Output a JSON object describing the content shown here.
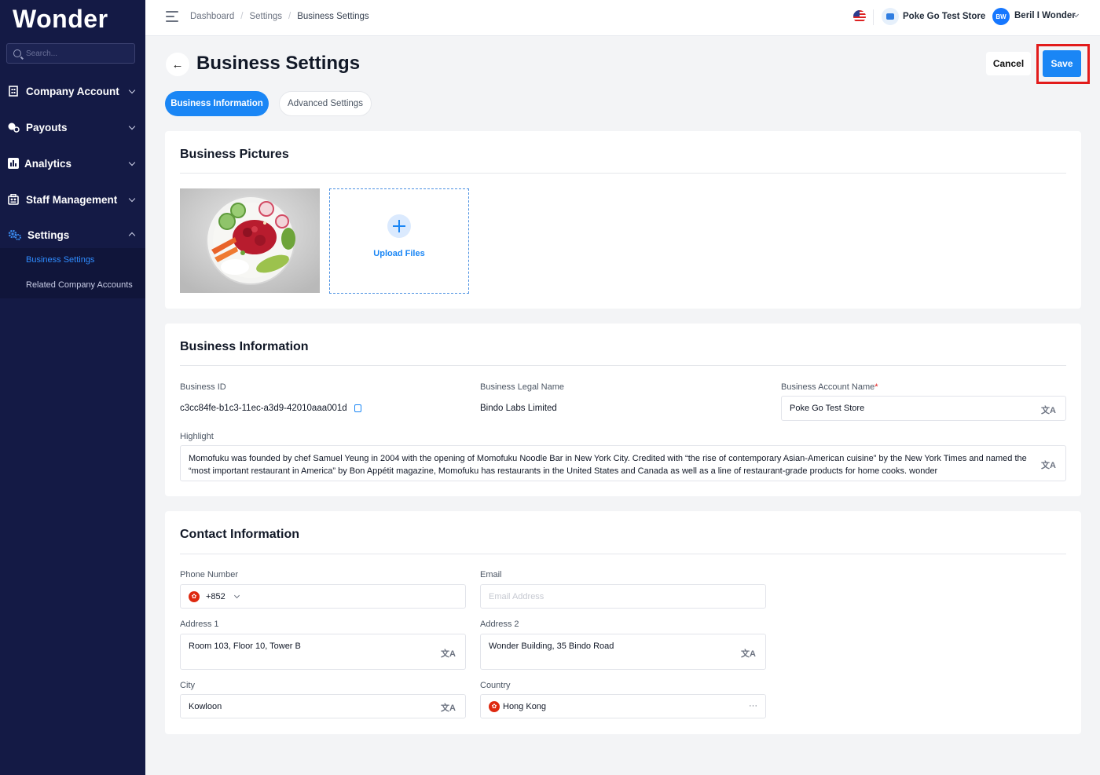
{
  "app": {
    "logo": "Wonder"
  },
  "sidebar": {
    "search_placeholder": "Search...",
    "items": [
      {
        "label": "Company Account",
        "icon": "building-icon"
      },
      {
        "label": "Payouts",
        "icon": "coins-icon"
      },
      {
        "label": "Analytics",
        "icon": "bar-chart-icon"
      },
      {
        "label": "Staff Management",
        "icon": "staff-icon"
      },
      {
        "label": "Settings",
        "icon": "gears-icon"
      }
    ],
    "settings_sub": [
      {
        "label": "Business Settings"
      },
      {
        "label": "Related Company Accounts"
      }
    ]
  },
  "topbar": {
    "breadcrumb": [
      "Dashboard",
      "Settings",
      "Business Settings"
    ],
    "store_name": "Poke Go Test Store",
    "avatar_initials": "BW",
    "user_name": "Beril I Wonder"
  },
  "page": {
    "title": "Business Settings",
    "back_arrow": "←",
    "cancel_label": "Cancel",
    "save_label": "Save",
    "tabs": [
      {
        "label": "Business Information",
        "active": true
      },
      {
        "label": "Advanced Settings",
        "active": false
      }
    ]
  },
  "pictures": {
    "title": "Business Pictures",
    "upload_label": "Upload Files"
  },
  "business_info": {
    "title": "Business Information",
    "id_label": "Business ID",
    "id_value": "c3cc84fe-b1c3-11ec-a3d9-42010aaa001d",
    "legal_label": "Business Legal Name",
    "legal_value": "Bindo Labs Limited",
    "account_name_label": "Business Account Name",
    "account_name_required": "*",
    "account_name_value": "Poke Go Test Store",
    "highlight_label": "Highlight",
    "highlight_value": "Momofuku was founded by chef Samuel Yeung in 2004 with the opening of Momofuku Noodle Bar in New York City. Credited with “the rise of contemporary Asian-American cuisine” by the New York Times and named the “most important restaurant in America” by Bon Appétit magazine, Momofuku has restaurants in the United States and Canada as well as a line of restaurant-grade products for home cooks. wonder"
  },
  "contact": {
    "title": "Contact Information",
    "phone_label": "Phone Number",
    "phone_code": "+852",
    "email_label": "Email",
    "email_placeholder": "Email Address",
    "address1_label": "Address 1",
    "address1_value": "Room 103, Floor 10, Tower B",
    "address2_label": "Address 2",
    "address2_value": "Wonder Building, 35 Bindo Road",
    "city_label": "City",
    "city_value": "Kowloon",
    "country_label": "Country",
    "country_value": "Hong Kong",
    "more_glyph": "···"
  },
  "translate_glyph": "文A",
  "colors": {
    "sidebar": "#141a45",
    "accent": "#1a86f5",
    "highlight_box": "#e21b1b"
  }
}
